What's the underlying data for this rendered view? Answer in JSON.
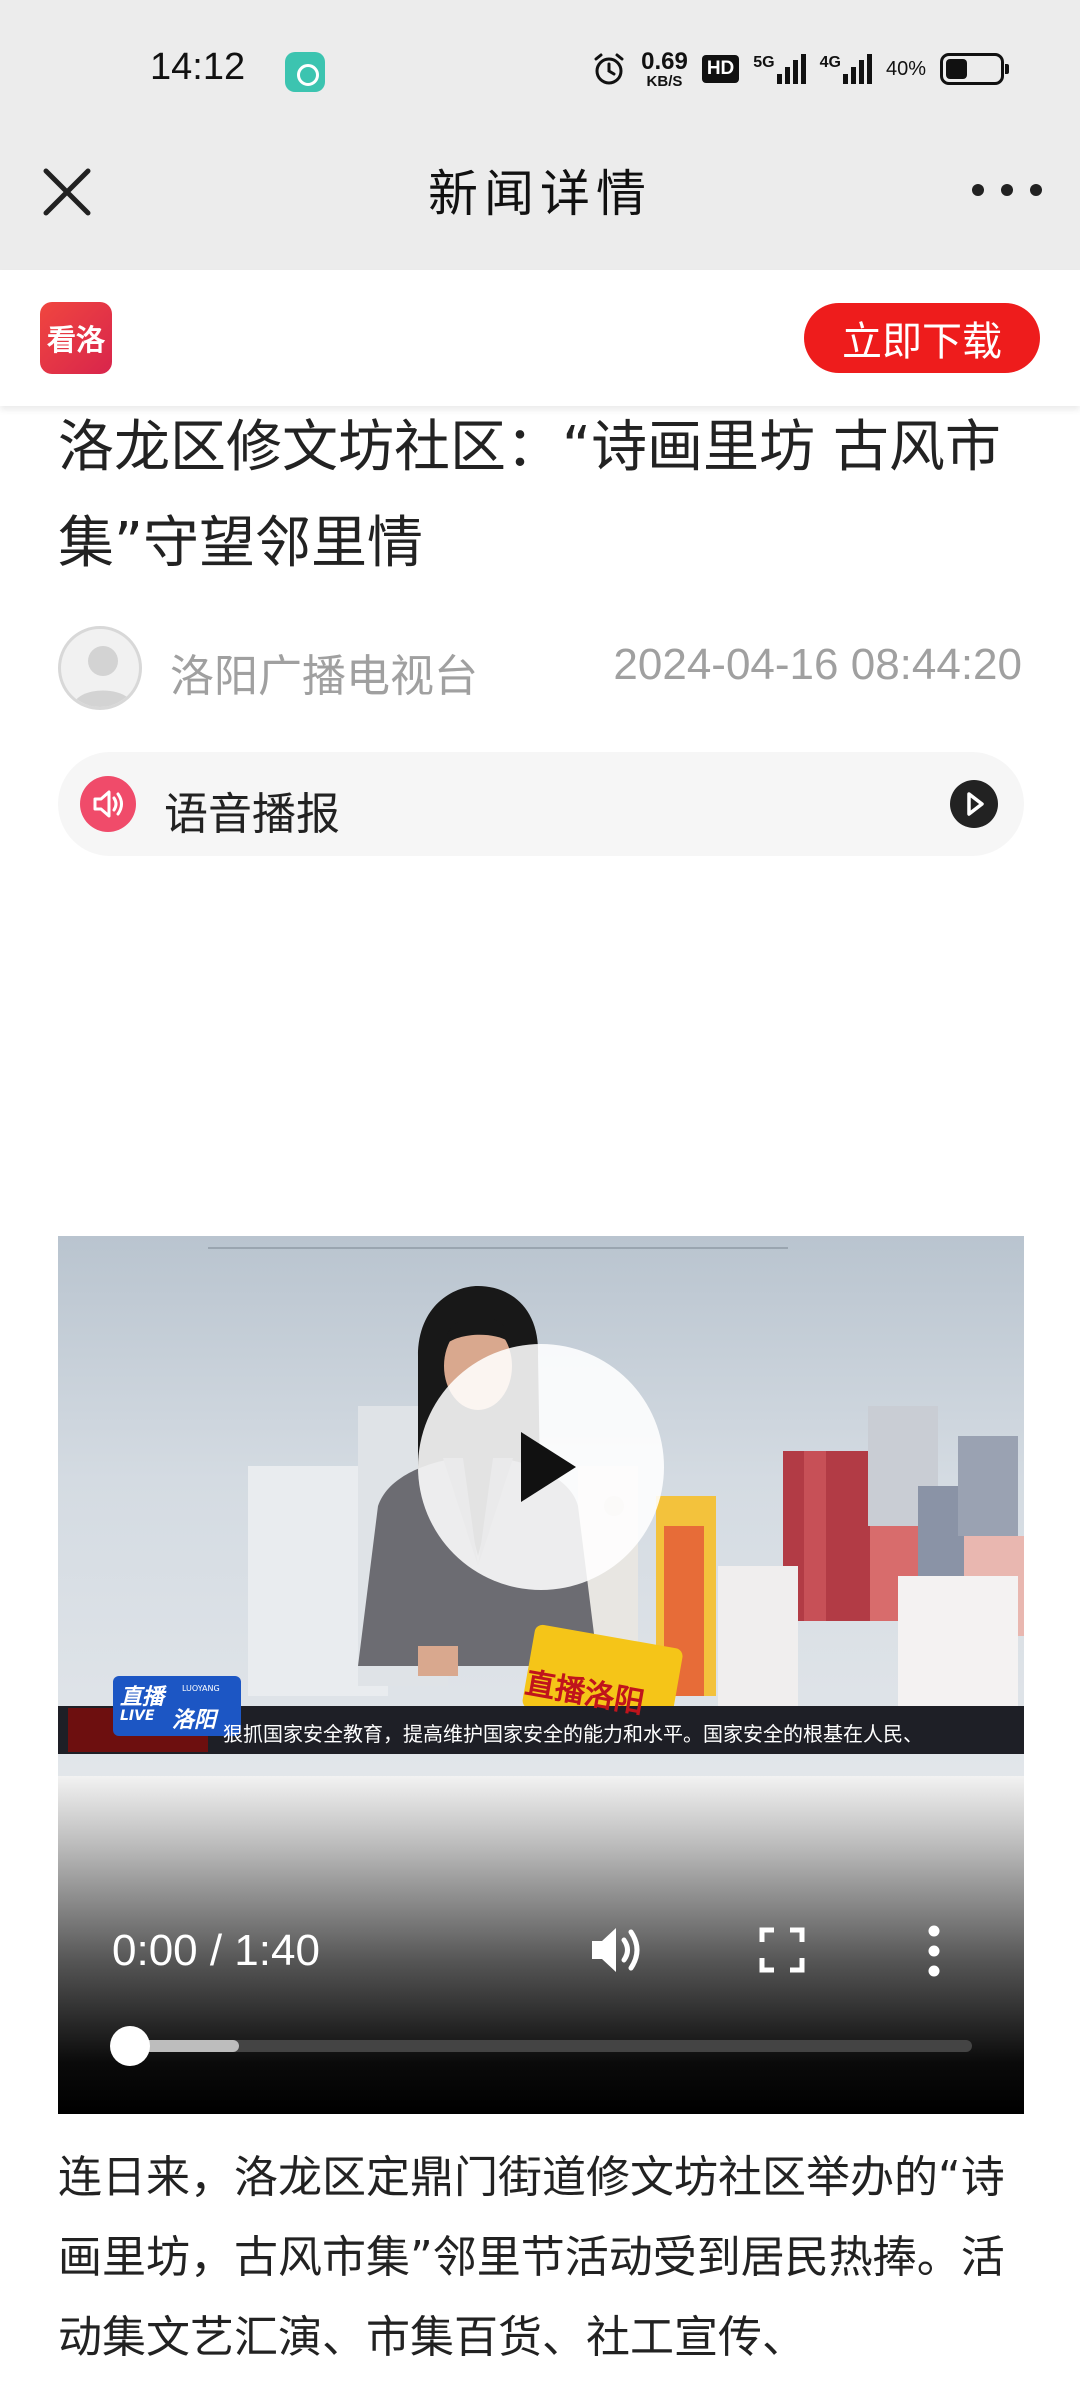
{
  "status_bar": {
    "time": "14:12",
    "net_speed": "0.69",
    "net_speed_unit": "KB/S",
    "hd_label": "HD",
    "network_1": "5G",
    "network_2": "4G",
    "battery": "40%",
    "battery_level": 0.4
  },
  "nav": {
    "title": "新闻详情",
    "close_icon": "close-icon",
    "more_icon": "more-dots-icon"
  },
  "banner": {
    "logo_text": "看洛",
    "download_label": "立即下载"
  },
  "article": {
    "title": "洛龙区修文坊社区：“诗画里坊 古风市集”守望邻里情",
    "author": "洛阳广播电视台",
    "published": "2024-04-16 08:44:20",
    "tts_label": "语音播报",
    "body": "连日来，洛龙区定鼎门街道修文坊社区举办的“诗画里坊，古风市集”邻里节活动受到居民热捧。活动集文艺汇演、市集百货、社工宣传、"
  },
  "video": {
    "time": "0:00 / 1:40",
    "progress": 0.0,
    "buffered": 0.13,
    "logo_top": "直播",
    "logo_sub": "LUOYANG",
    "logo_live": "LIVE",
    "logo_city": "洛阳",
    "card_text": "直播洛阳",
    "ticker": "狠抓国家安全教育，提高维护国家安全的能力和水平。国家安全的根基在人民、"
  },
  "colors": {
    "accent_red": "#ee1c1c",
    "tts_pink": "#f04b6a",
    "meta_gray": "#a0a0a0"
  }
}
